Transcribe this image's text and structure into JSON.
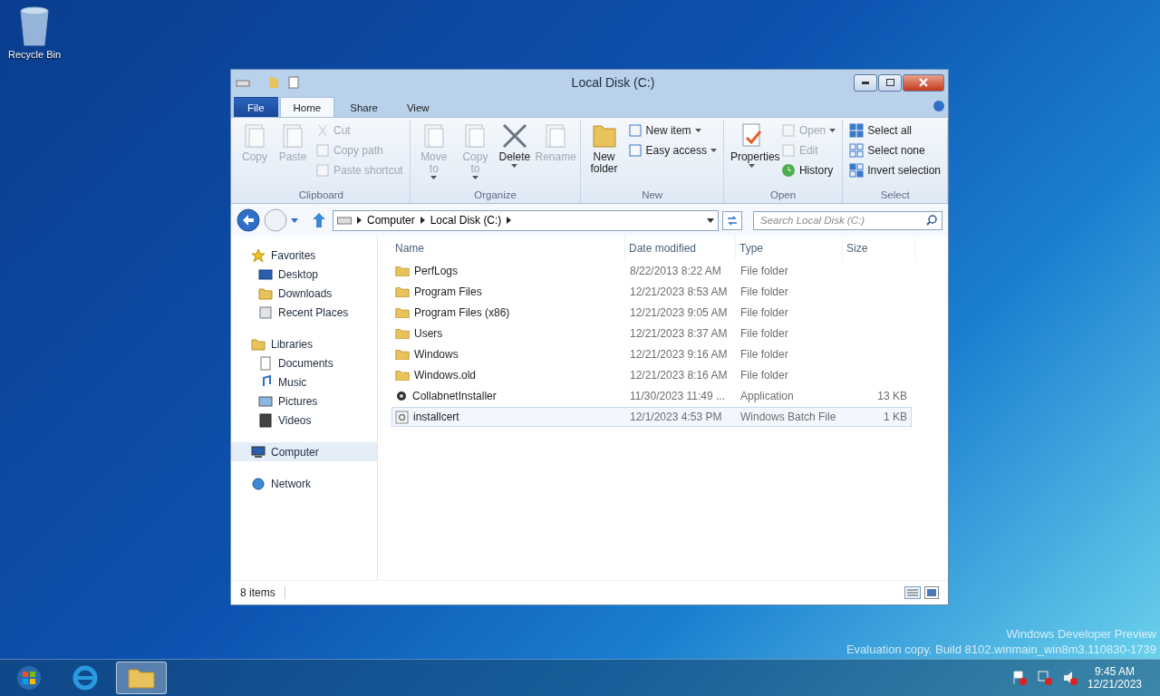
{
  "desktop": {
    "icons": [
      {
        "label": "Recycle Bin"
      }
    ],
    "watermark_lines": [
      "Windows Developer Preview",
      "Evaluation copy. Build 8102.winmain_win8m3.110830-1739"
    ]
  },
  "window": {
    "title": "Local Disk (C:)",
    "tabs": [
      {
        "label": "File",
        "kind": "file",
        "selected": false
      },
      {
        "label": "Home",
        "kind": "tab",
        "selected": true
      },
      {
        "label": "Share",
        "kind": "tab",
        "selected": false
      },
      {
        "label": "View",
        "kind": "tab",
        "selected": false
      }
    ],
    "ribbon": [
      {
        "label": "Clipboard",
        "items": [
          {
            "label": "Copy",
            "kind": "large",
            "disabled": true,
            "caret": false
          },
          {
            "label": "Paste",
            "kind": "large",
            "disabled": true,
            "caret": false
          },
          {
            "kind": "stack",
            "items": [
              {
                "label": "Cut",
                "disabled": true,
                "caret": false
              },
              {
                "label": "Copy path",
                "disabled": true,
                "caret": false
              },
              {
                "label": "Paste shortcut",
                "disabled": true,
                "caret": false
              }
            ]
          }
        ]
      },
      {
        "label": "Organize",
        "items": [
          {
            "label": "Move to",
            "kind": "large",
            "disabled": true,
            "caret": true
          },
          {
            "label": "Copy to",
            "kind": "large",
            "disabled": true,
            "caret": true
          },
          {
            "label": "Delete",
            "kind": "large",
            "disabled": false,
            "caret": true
          },
          {
            "label": "Rename",
            "kind": "large",
            "disabled": true,
            "caret": false
          }
        ]
      },
      {
        "label": "New",
        "items": [
          {
            "label": "New folder",
            "kind": "large",
            "disabled": false,
            "caret": false
          },
          {
            "kind": "stack",
            "items": [
              {
                "label": "New item",
                "disabled": false,
                "caret": true
              },
              {
                "label": "Easy access",
                "disabled": false,
                "caret": true
              }
            ]
          }
        ]
      },
      {
        "label": "Open",
        "items": [
          {
            "label": "Properties",
            "kind": "large",
            "disabled": false,
            "caret": true
          },
          {
            "kind": "stack",
            "items": [
              {
                "label": "Open",
                "disabled": true,
                "caret": true
              },
              {
                "label": "Edit",
                "disabled": true,
                "caret": false
              },
              {
                "label": "History",
                "disabled": false,
                "caret": false
              }
            ]
          }
        ]
      },
      {
        "label": "Select",
        "items": [
          {
            "kind": "stack",
            "items": [
              {
                "label": "Select all",
                "disabled": false,
                "caret": false
              },
              {
                "label": "Select none",
                "disabled": false,
                "caret": false
              },
              {
                "label": "Invert selection",
                "disabled": false,
                "caret": false
              }
            ]
          }
        ]
      }
    ],
    "address": {
      "crumbs": [
        "Computer",
        "Local Disk (C:)"
      ],
      "search_placeholder": "Search Local Disk (C:)"
    },
    "navigation": [
      {
        "label": "Favorites",
        "selected": false,
        "children": [
          {
            "label": "Desktop",
            "selected": false
          },
          {
            "label": "Downloads",
            "selected": false
          },
          {
            "label": "Recent Places",
            "selected": false
          }
        ]
      },
      {
        "label": "Libraries",
        "selected": false,
        "children": [
          {
            "label": "Documents",
            "selected": false
          },
          {
            "label": "Music",
            "selected": false
          },
          {
            "label": "Pictures",
            "selected": false
          },
          {
            "label": "Videos",
            "selected": false
          }
        ]
      },
      {
        "label": "Computer",
        "selected": true
      },
      {
        "label": "Network",
        "selected": false
      }
    ],
    "columns": [
      "Name",
      "Date modified",
      "Type",
      "Size"
    ],
    "rows": [
      {
        "name": "PerfLogs",
        "date": "8/22/2013 8:22 AM",
        "type": "File folder",
        "kind": "folder",
        "selected": false
      },
      {
        "name": "Program Files",
        "date": "12/21/2023 8:53 AM",
        "type": "File folder",
        "kind": "folder",
        "selected": false
      },
      {
        "name": "Program Files (x86)",
        "date": "12/21/2023 9:05 AM",
        "type": "File folder",
        "kind": "folder",
        "selected": false
      },
      {
        "name": "Users",
        "date": "12/21/2023 8:37 AM",
        "type": "File folder",
        "kind": "folder",
        "selected": false
      },
      {
        "name": "Windows",
        "date": "12/21/2023 9:16 AM",
        "type": "File folder",
        "kind": "folder",
        "selected": false
      },
      {
        "name": "Windows.old",
        "date": "12/21/2023 8:16 AM",
        "type": "File folder",
        "kind": "folder",
        "selected": false
      },
      {
        "name": "CollabnetInstaller",
        "date": "11/30/2023 11:49 ...",
        "type": "Application",
        "size": "13 KB",
        "kind": "app",
        "selected": false
      },
      {
        "name": "installcert",
        "date": "12/1/2023 4:53 PM",
        "type": "Windows Batch File",
        "size": "1 KB",
        "kind": "batch",
        "selected": true
      }
    ],
    "status": "8 items"
  },
  "taskbar": {
    "time": "9:45 AM",
    "date": "12/21/2023"
  }
}
